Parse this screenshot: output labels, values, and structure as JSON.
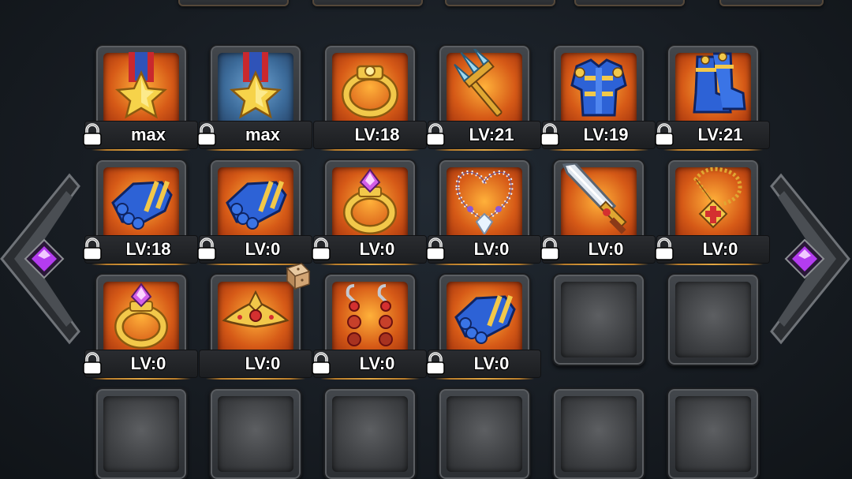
{
  "colors": {
    "slot_orange": "#d65a17",
    "slot_blue": "#3c6b9a",
    "label_text": "#ffffff",
    "gold_divider": "#e2a744",
    "gem": "#b43cf0"
  },
  "navigation": {
    "prev_icon": "diamond-arrow-left-icon",
    "next_icon": "diamond-arrow-right-icon"
  },
  "slots": [
    {
      "icon": "star-medal-icon",
      "level": "max",
      "locked": true,
      "bg": "orange"
    },
    {
      "icon": "star-medal-icon",
      "level": "max",
      "locked": true,
      "bg": "blue"
    },
    {
      "icon": "gold-ring-icon",
      "level": "LV:18",
      "locked": false,
      "bg": "orange"
    },
    {
      "icon": "trident-icon",
      "level": "LV:21",
      "locked": true,
      "bg": "orange"
    },
    {
      "icon": "blue-armor-icon",
      "level": "LV:19",
      "locked": true,
      "bg": "orange"
    },
    {
      "icon": "blue-boots-icon",
      "level": "LV:21",
      "locked": true,
      "bg": "orange"
    },
    {
      "icon": "blue-gauntlet-icon",
      "level": "LV:18",
      "locked": true,
      "bg": "orange"
    },
    {
      "icon": "blue-gauntlet-icon",
      "level": "LV:0",
      "locked": true,
      "bg": "orange"
    },
    {
      "icon": "gem-ring-icon",
      "level": "LV:0",
      "locked": true,
      "bg": "orange"
    },
    {
      "icon": "pearl-necklace-icon",
      "level": "LV:0",
      "locked": true,
      "bg": "orange"
    },
    {
      "icon": "sword-icon",
      "level": "LV:0",
      "locked": true,
      "bg": "orange"
    },
    {
      "icon": "gold-amulet-icon",
      "level": "LV:0",
      "locked": true,
      "bg": "orange"
    },
    {
      "icon": "gem-ring-icon",
      "level": "LV:0",
      "locked": true,
      "bg": "orange"
    },
    {
      "icon": "tiara-icon",
      "level": "LV:0",
      "locked": false,
      "bg": "orange"
    },
    {
      "icon": "earrings-icon",
      "level": "LV:0",
      "locked": true,
      "bg": "orange"
    },
    {
      "icon": "blue-gauntlet-icon",
      "level": "LV:0",
      "locked": true,
      "bg": "orange"
    },
    {
      "icon": "",
      "level": "",
      "locked": false,
      "bg": "empty"
    },
    {
      "icon": "",
      "level": "",
      "locked": false,
      "bg": "empty"
    },
    {
      "icon": "",
      "level": "",
      "locked": false,
      "bg": "empty"
    },
    {
      "icon": "",
      "level": "",
      "locked": false,
      "bg": "empty"
    },
    {
      "icon": "",
      "level": "",
      "locked": false,
      "bg": "empty"
    },
    {
      "icon": "",
      "level": "",
      "locked": false,
      "bg": "empty"
    },
    {
      "icon": "",
      "level": "",
      "locked": false,
      "bg": "empty"
    },
    {
      "icon": "",
      "level": "",
      "locked": false,
      "bg": "empty"
    }
  ]
}
